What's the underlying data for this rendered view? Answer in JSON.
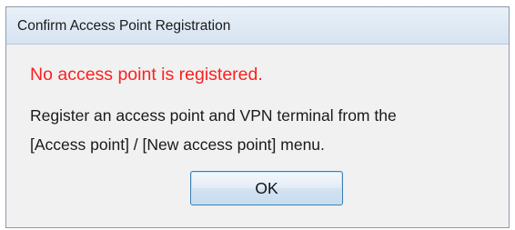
{
  "dialog": {
    "title": "Confirm Access Point Registration",
    "error_message": "No access point is registered.",
    "body_line1": "Register an access point and VPN terminal from the",
    "body_line2": "[Access point] / [New access point] menu.",
    "ok_label": "OK"
  },
  "colors": {
    "error_text": "#ff1f1f",
    "titlebar": "#dde7f3",
    "client_background": "#f1f1f1",
    "button_border": "#3c7fb1"
  }
}
